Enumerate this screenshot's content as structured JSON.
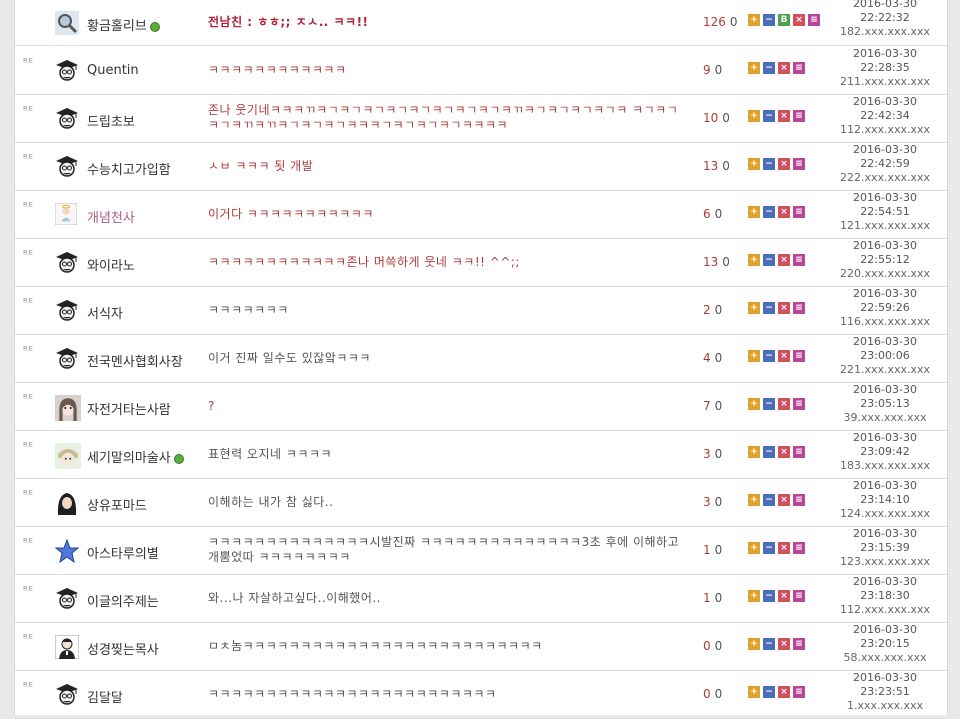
{
  "colors": {
    "upvote": "#e0a32a",
    "downvote": "#4b6fb7",
    "recommend": "#4ba34b",
    "delete": "#d24e5a",
    "report": "#b8479a",
    "comment_text": "#b03a3a"
  },
  "comments": [
    {
      "re": "",
      "nick": "황금홀리브",
      "online": true,
      "avatar": "magnifier-avatar-icon",
      "text": "전남친 : ㅎㅎ;; ㅈㅅ.. ㅋㅋ!!",
      "up": "126",
      "down": "0",
      "date": "2016-03-30",
      "time": "22:22:32",
      "ip": "182.xxx.xxx.xxx"
    },
    {
      "re": "RE",
      "nick": "Quentin",
      "online": false,
      "avatar": "scholar-avatar-icon",
      "text": "ㅋㅋㅋㅋㅋㅋㅋㅋㅋㅋㅋㅋ",
      "up": "9",
      "down": "0",
      "date": "2016-03-30",
      "time": "22:28:35",
      "ip": "211.xxx.xxx.xxx"
    },
    {
      "re": "RE",
      "nick": "드립초보",
      "online": false,
      "avatar": "scholar-avatar-icon",
      "text": "존나 웃기네ㅋㅋㅋㄲㅋㄱㅋㄱㅋㄱㅋㄱㅋㄱㅋㄱㅋㄱㅋㄱㅋㄲㅋㄱㅋㄱㅋㄱㅋㄱㅋ ㅋㄱㅋㄱㅋㄱㅋㄲㅋㄲㅋㄱㅋㄱㅋㄱㅋㅋㅋㄱㅋㄱㅋㄱㅋㄱㅋㅋㅋㅋ",
      "up": "10",
      "down": "0",
      "date": "2016-03-30",
      "time": "22:42:34",
      "ip": "112.xxx.xxx.xxx"
    },
    {
      "re": "RE",
      "nick": "수능치고가입함",
      "online": false,
      "avatar": "scholar-avatar-icon",
      "text": "ㅅㅂ ㅋㅋㅋ 됫 개발",
      "up": "13",
      "down": "0",
      "date": "2016-03-30",
      "time": "22:42:59",
      "ip": "222.xxx.xxx.xxx"
    },
    {
      "re": "RE",
      "nick": "개념천사",
      "online": false,
      "avatar": "angel-avatar-icon",
      "text": "이거다 ㅋㅋㅋㅋㅋㅋㅋㅋㅋㅋㅋ",
      "up": "6",
      "down": "0",
      "date": "2016-03-30",
      "time": "22:54:51",
      "ip": "121.xxx.xxx.xxx"
    },
    {
      "re": "RE",
      "nick": "와이라노",
      "online": false,
      "avatar": "scholar-avatar-icon",
      "text": "ㅋㅋㅋㅋㅋㅋㅋㅋㅋㅋㅋㅋ존나 머쓱하게 웃네 ㅋㅋ!! ^^;;",
      "up": "13",
      "down": "0",
      "date": "2016-03-30",
      "time": "22:55:12",
      "ip": "220.xxx.xxx.xxx"
    },
    {
      "re": "RE",
      "nick": "서식자",
      "online": false,
      "avatar": "scholar-avatar-icon",
      "text": "ㅋㅋㅋㅋㅋㅋㅋ",
      "up": "2",
      "down": "0",
      "date": "2016-03-30",
      "time": "22:59:26",
      "ip": "116.xxx.xxx.xxx"
    },
    {
      "re": "RE",
      "nick": "전국멘사협회사장",
      "online": false,
      "avatar": "scholar-avatar-icon",
      "text": "이거 진짜 일수도 있잖앜ㅋㅋㅋ",
      "up": "4",
      "down": "0",
      "date": "2016-03-30",
      "time": "23:00:06",
      "ip": "221.xxx.xxx.xxx"
    },
    {
      "re": "RE",
      "nick": "자전거타는사람",
      "online": false,
      "avatar": "girl-avatar-icon",
      "text": "?",
      "up": "7",
      "down": "0",
      "date": "2016-03-30",
      "time": "23:05:13",
      "ip": "39.xxx.xxx.xxx"
    },
    {
      "re": "RE",
      "nick": "세기말의마술사",
      "online": true,
      "avatar": "cartoon-avatar-icon",
      "text": "표현력 오지네 ㅋㅋㅋㅋ",
      "up": "3",
      "down": "0",
      "date": "2016-03-30",
      "time": "23:09:42",
      "ip": "183.xxx.xxx.xxx"
    },
    {
      "re": "RE",
      "nick": "상유포마드",
      "online": false,
      "avatar": "hooded-avatar-icon",
      "text": "이해하는 내가 참 싫다..",
      "up": "3",
      "down": "0",
      "date": "2016-03-30",
      "time": "23:14:10",
      "ip": "124.xxx.xxx.xxx"
    },
    {
      "re": "RE",
      "nick": "아스타루의별",
      "online": false,
      "avatar": "star-avatar-icon",
      "text": "ㅋㅋㅋㅋㅋㅋㅋㅋㅋㅋㅋㅋㅋㅋ시발진짜 ㅋㅋㅋㅋㅋㅋㅋㅋㅋㅋㅋㅋㅋㅋ3초 후에 이해하고 개뿜었따 ㅋㅋㅋㅋㅋㅋㅋㅋ",
      "up": "1",
      "down": "0",
      "date": "2016-03-30",
      "time": "23:15:39",
      "ip": "123.xxx.xxx.xxx"
    },
    {
      "re": "RE",
      "nick": "이글의주제는",
      "online": false,
      "avatar": "scholar-avatar-icon",
      "text": "와...나 자살하고싶다..이해했어..",
      "up": "1",
      "down": "0",
      "date": "2016-03-30",
      "time": "23:18:30",
      "ip": "112.xxx.xxx.xxx"
    },
    {
      "re": "RE",
      "nick": "성경찢는목사",
      "online": false,
      "avatar": "priest-avatar-icon",
      "text": "ㅁㅊ놈ㅋㅋㅋㅋㅋㅋㅋㅋㅋㅋㅋㅋㅋㅋㅋㅋㅋㅋㅋㅋㅋㅋㅋㅋㅋㅋ",
      "up": "0",
      "down": "0",
      "date": "2016-03-30",
      "time": "23:20:15",
      "ip": "58.xxx.xxx.xxx"
    },
    {
      "re": "RE",
      "nick": "김달달",
      "online": false,
      "avatar": "scholar-avatar-icon",
      "text": "ㅋㅋㅋㅋㅋㅋㅋㅋㅋㅋㅋㅋㅋㅋㅋㅋㅋㅋㅋㅋㅋㅋㅋㅋㅋ",
      "up": "0",
      "down": "0",
      "date": "2016-03-30",
      "time": "23:23:51",
      "ip": "1.xxx.xxx.xxx"
    }
  ]
}
